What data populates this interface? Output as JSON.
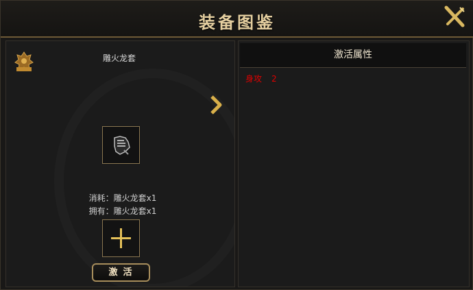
{
  "window": {
    "title": "装备图鉴"
  },
  "left": {
    "item_name": "雕火龙套",
    "cost_line": "消耗：雕火龙套x1",
    "own_line": "拥有：雕火龙套x1",
    "activate_label": "激活"
  },
  "right": {
    "header": "激活属性",
    "attributes": [
      {
        "label": "身攻",
        "value": "2"
      }
    ]
  },
  "colors": {
    "title_gold": "#e5cfa0",
    "border_gold": "#8a7650",
    "attr_red": "#e00000"
  }
}
